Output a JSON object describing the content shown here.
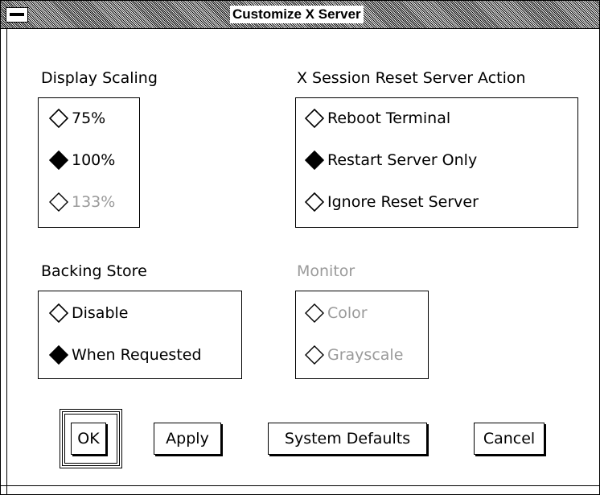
{
  "window": {
    "title": "Customize X Server"
  },
  "display_scaling": {
    "label": "Display Scaling",
    "options": [
      {
        "label": "75%",
        "selected": false,
        "enabled": true
      },
      {
        "label": "100%",
        "selected": true,
        "enabled": true
      },
      {
        "label": "133%",
        "selected": false,
        "enabled": false
      }
    ]
  },
  "reset_action": {
    "label": "X Session Reset Server Action",
    "options": [
      {
        "label": "Reboot Terminal",
        "selected": false,
        "enabled": true
      },
      {
        "label": "Restart Server Only",
        "selected": true,
        "enabled": true
      },
      {
        "label": "Ignore Reset Server",
        "selected": false,
        "enabled": true
      }
    ]
  },
  "backing_store": {
    "label": "Backing Store",
    "options": [
      {
        "label": "Disable",
        "selected": false,
        "enabled": true
      },
      {
        "label": "When Requested",
        "selected": true,
        "enabled": true
      }
    ]
  },
  "monitor": {
    "label": "Monitor",
    "enabled": false,
    "options": [
      {
        "label": "Color",
        "selected": false,
        "enabled": false
      },
      {
        "label": "Grayscale",
        "selected": false,
        "enabled": false
      }
    ]
  },
  "buttons": {
    "ok": "OK",
    "apply": "Apply",
    "system_defaults": "System Defaults",
    "cancel": "Cancel"
  },
  "colors": {
    "disabled_text": "#9a9a9a",
    "border": "#000000"
  }
}
